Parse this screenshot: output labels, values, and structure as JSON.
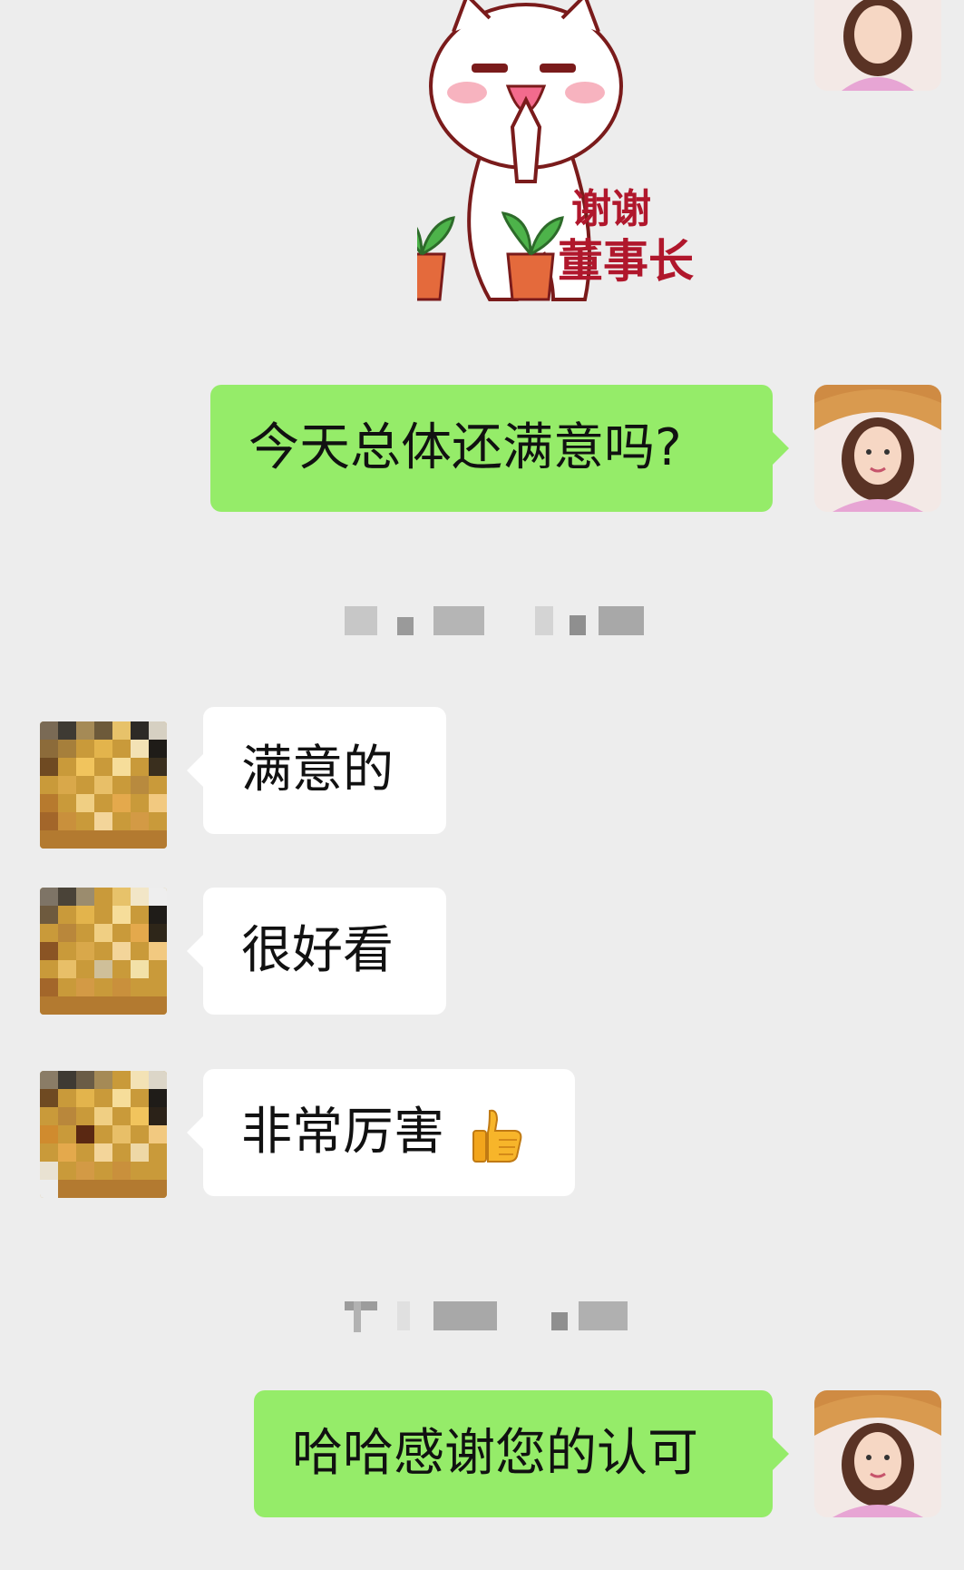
{
  "sticker": {
    "caption_line1": "谢谢",
    "caption_line2": "董事长"
  },
  "messages": [
    {
      "side": "right",
      "sender": "me",
      "text": "今天总体还满意吗?"
    },
    {
      "side": "left",
      "sender": "other",
      "text": "满意的"
    },
    {
      "side": "left",
      "sender": "other",
      "text": "很好看"
    },
    {
      "side": "left",
      "sender": "other",
      "text": "非常厉害",
      "emoji": "thumbs-up"
    },
    {
      "side": "right",
      "sender": "me",
      "text": "哈哈感谢您的认可"
    }
  ],
  "colors": {
    "background": "#ededed",
    "sent_bubble": "#95ec69",
    "received_bubble": "#ffffff"
  },
  "icons": {
    "other_avatar": "pixelated-avatar",
    "my_avatar": "woman-with-hat-avatar",
    "reaction": "thumbs-up-icon"
  }
}
